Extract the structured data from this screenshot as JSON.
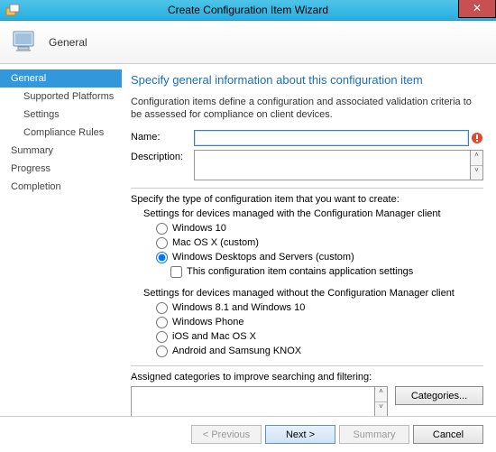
{
  "window": {
    "title": "Create Configuration Item Wizard"
  },
  "header": {
    "step": "General"
  },
  "sidebar": {
    "items": [
      {
        "label": "General",
        "active": true
      },
      {
        "label": "Supported Platforms",
        "sub": true
      },
      {
        "label": "Settings",
        "sub": true
      },
      {
        "label": "Compliance Rules",
        "sub": true
      },
      {
        "label": "Summary"
      },
      {
        "label": "Progress"
      },
      {
        "label": "Completion"
      }
    ]
  },
  "page": {
    "title": "Specify general information about this configuration item",
    "intro": "Configuration items define a configuration and associated validation criteria to be assessed for compliance on client devices.",
    "name_label": "Name:",
    "name_value": "",
    "desc_label": "Description:",
    "desc_value": "",
    "type_label": "Specify the type of configuration item that you want to create:",
    "group_with": "Settings for devices managed with the Configuration Manager client",
    "opts_with": [
      "Windows 10",
      "Mac OS X (custom)",
      "Windows Desktops and Servers (custom)"
    ],
    "selected_with": 2,
    "app_settings_label": "This configuration item contains application settings",
    "app_settings_checked": false,
    "group_without": "Settings for devices managed without the Configuration Manager client",
    "opts_without": [
      "Windows 8.1 and Windows 10",
      "Windows Phone",
      "iOS and Mac OS X",
      "Android and Samsung KNOX"
    ],
    "cats_label": "Assigned categories to improve searching and filtering:",
    "cats_button": "Categories..."
  },
  "buttons": {
    "previous": "< Previous",
    "next": "Next >",
    "summary": "Summary",
    "cancel": "Cancel"
  }
}
